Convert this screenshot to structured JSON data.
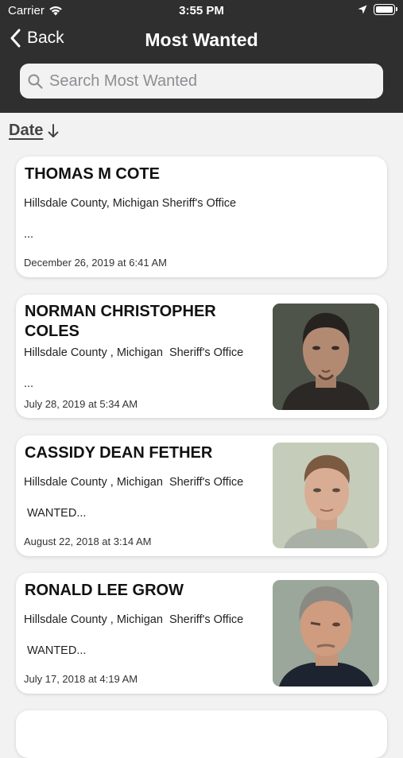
{
  "status": {
    "carrier": "Carrier",
    "time": "3:55 PM"
  },
  "nav": {
    "back_label": "Back",
    "title": "Most Wanted"
  },
  "search": {
    "placeholder": "Search Most Wanted",
    "value": ""
  },
  "sort": {
    "label": "Date"
  },
  "records": [
    {
      "name": "THOMAS M COTE",
      "agency": "Hillsdale County, Michigan Sheriff's Office",
      "snippet": "...",
      "date": "December 26, 2019 at 6:41 AM"
    },
    {
      "name": "NORMAN CHRISTOPHER COLES",
      "agency": "Hillsdale County , Michigan  Sheriff's Office",
      "snippet": "...",
      "date": "July 28, 2019 at 5:34 AM"
    },
    {
      "name": "CASSIDY DEAN FETHER",
      "agency": "Hillsdale County , Michigan  Sheriff's Office",
      "snippet": " WANTED...",
      "date": "August 22, 2018 at 3:14 AM"
    },
    {
      "name": "RONALD LEE GROW",
      "agency": "Hillsdale County , Michigan  Sheriff's Office",
      "snippet": " WANTED...",
      "date": "July 17, 2018 at 4:19 AM"
    }
  ]
}
